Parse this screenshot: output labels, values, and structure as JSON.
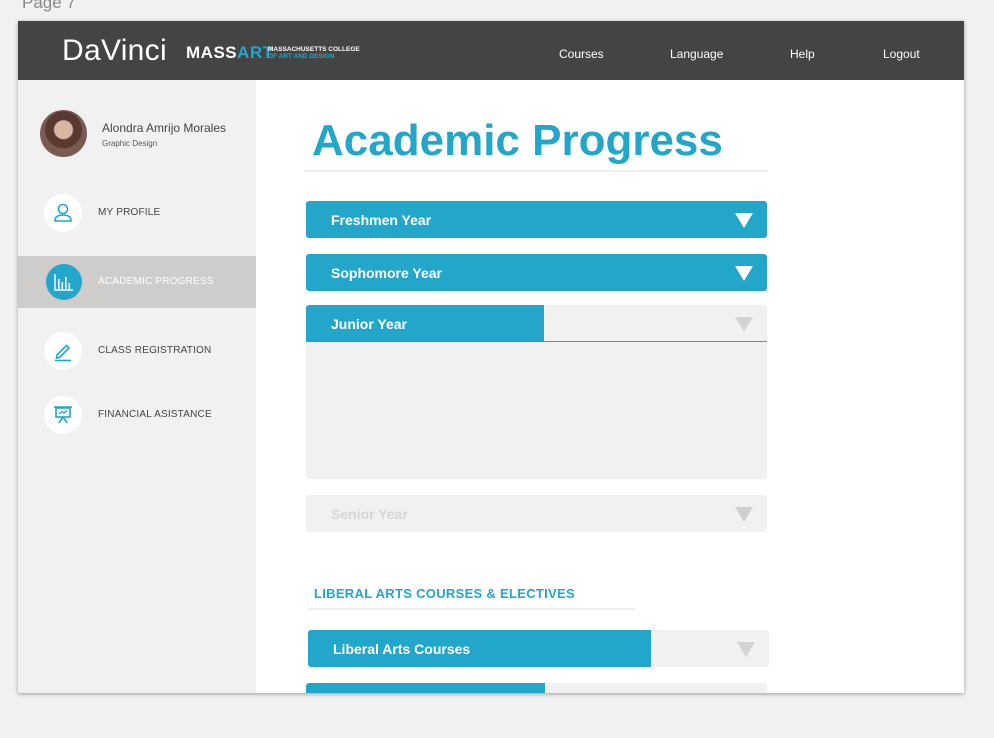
{
  "page_label": "Page 7",
  "header": {
    "brand": "DaVinci",
    "logo": {
      "mass": "MASS",
      "art": "ART",
      "line1": "MASSACHUSETTS COLLEGE",
      "line2": "OF ART AND DESIGN"
    },
    "nav": [
      "Courses",
      "Language",
      "Help",
      "Logout"
    ]
  },
  "user": {
    "name": "Alondra Amrijo Morales",
    "program": "Graphic Design"
  },
  "sidebar": {
    "items": [
      {
        "label": "MY PROFILE",
        "icon": "user-icon",
        "active": false
      },
      {
        "label": "ACADEMIC PROGRESS",
        "icon": "bar-chart-icon",
        "active": true
      },
      {
        "label": "CLASS REGISTRATION",
        "icon": "pencil-icon",
        "active": false
      },
      {
        "label": "FINANCIAL ASISTANCE",
        "icon": "presentation-board-icon",
        "active": false
      }
    ]
  },
  "main": {
    "title": "Academic Progress",
    "years": [
      {
        "label": "Freshmen Year",
        "state": "complete",
        "progress": 1.0
      },
      {
        "label": "Sophomore Year",
        "state": "complete",
        "progress": 1.0
      },
      {
        "label": "Junior Year",
        "state": "in-progress-expanded",
        "progress": 0.51
      },
      {
        "label": "Senior Year",
        "state": "disabled",
        "progress": 0.0
      }
    ],
    "section_heading": "LIBERAL ARTS COURSES & ELECTIVES",
    "courses": [
      {
        "label": "Liberal Arts Courses",
        "progress": 0.75
      },
      {
        "label": "",
        "progress": 0.51
      }
    ]
  },
  "colors": {
    "accent": "#22a6c9",
    "header_bg": "#444444",
    "sidebar_bg": "#f1f1f1",
    "active_item_bg": "#cfcccc"
  }
}
